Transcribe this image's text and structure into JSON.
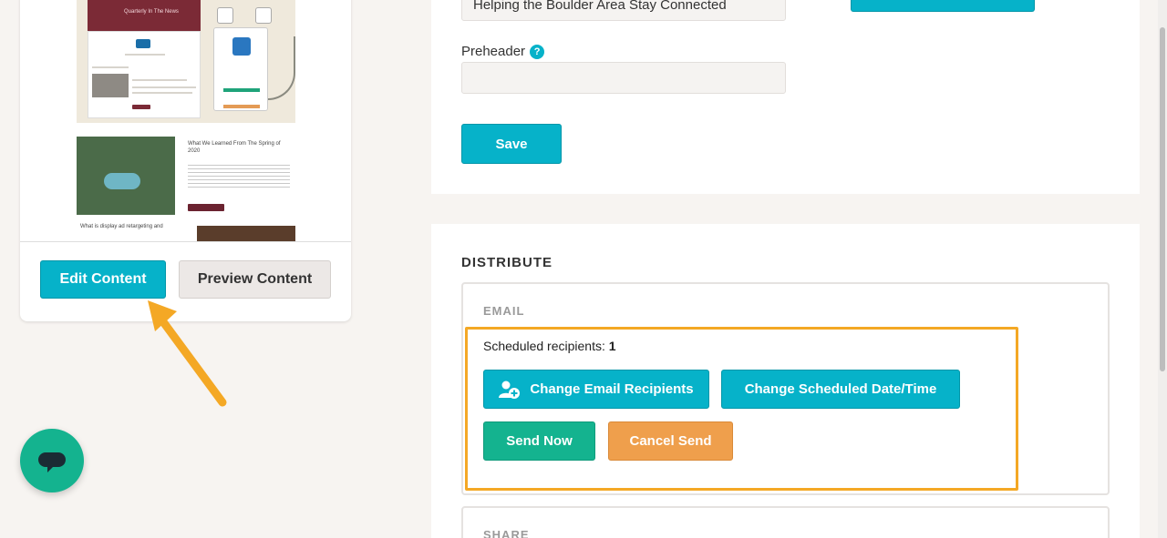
{
  "preview": {
    "thumbnail": {
      "banner_text": "Quarterly In The News",
      "article_title": "What We Learned From The Spring of 2020",
      "article_title_2": "What is display ad retargeting and"
    },
    "edit_button": "Edit Content",
    "preview_button": "Preview Content"
  },
  "settings": {
    "subject_value": "Helping the Boulder Area Stay Connected",
    "preheader_label": "Preheader",
    "preheader_help": "?",
    "preheader_value": "",
    "save_button": "Save"
  },
  "distribute": {
    "title": "DISTRIBUTE",
    "email": {
      "label": "EMAIL",
      "scheduled_label": "Scheduled recipients:",
      "scheduled_count": "1",
      "change_recipients": "Change Email Recipients",
      "change_date": "Change Scheduled Date/Time",
      "send_now": "Send Now",
      "cancel_send": "Cancel Send"
    },
    "share": {
      "label": "SHARE"
    }
  },
  "colors": {
    "primary": "#06b2c9",
    "success": "#14b38f",
    "warning": "#ef9f4c",
    "highlight": "#f4a825",
    "brand_maroon": "#7b2a36"
  },
  "icons": {
    "chat": "chat-bubble-icon",
    "add_user": "add-user-icon",
    "help": "help-icon",
    "annotation_arrow": "arrow-icon"
  }
}
